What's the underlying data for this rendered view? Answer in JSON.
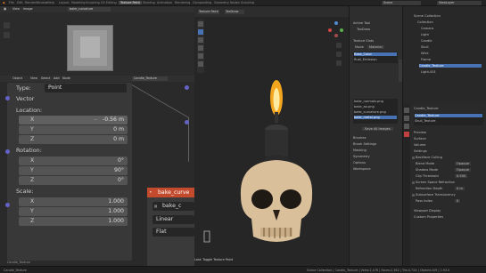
{
  "topbar": {
    "menus": [
      "File",
      "Edit",
      "Render",
      "Window",
      "Help"
    ],
    "workspaces": [
      "Layout",
      "Modeling",
      "Sculpting",
      "UV Editing",
      "Texture Paint",
      "Shading",
      "Animation",
      "Rendering",
      "Compositing",
      "Geometry Nodes",
      "Scripting"
    ],
    "active_workspace": "Texture Paint",
    "scene": "Scene",
    "view_layer": "ViewLayer"
  },
  "image_editor": {
    "menus": [
      "View",
      "Image"
    ],
    "image_name": "bake_curvature"
  },
  "node_editor": {
    "header": [
      "Object",
      "View",
      "Select",
      "Add",
      "Node"
    ],
    "material": "Candle_Texture",
    "panel": {
      "type_label": "Type:",
      "type_value": "Point",
      "vector_label": "Vector",
      "location_label": "Location:",
      "location": [
        {
          "axis": "X",
          "value": "-0.56 m"
        },
        {
          "axis": "Y",
          "value": "0 m"
        },
        {
          "axis": "Z",
          "value": "0 m"
        }
      ],
      "rotation_label": "Rotation:",
      "rotation": [
        {
          "axis": "X",
          "value": "0°"
        },
        {
          "axis": "Y",
          "value": "90°"
        },
        {
          "axis": "Z",
          "value": "0°"
        }
      ],
      "scale_label": "Scale:",
      "scale": [
        {
          "axis": "X",
          "value": "1.000"
        },
        {
          "axis": "Y",
          "value": "1.000"
        },
        {
          "axis": "Z",
          "value": "1.000"
        }
      ]
    },
    "bake_node": {
      "title": "bake_curve",
      "image": "bake_c",
      "interp": "Linear",
      "proj": "Flat"
    },
    "footer_label": "Candle_Texture"
  },
  "viewport": {
    "mode": "Texture Paint",
    "brush": "TexDraw",
    "overlay_label": "Last: Toggle Texture Paint"
  },
  "tool_panel": {
    "tabs": [
      "Tool",
      "View"
    ],
    "active_tool_label": "Active Tool",
    "brush_name": "TexDraw",
    "texture_slots_label": "Texture Slots",
    "mode_label": "Mode",
    "mode_value": "Material",
    "slots": [
      "Base_Color",
      "Rust_Emission"
    ],
    "image_list": [
      "bake_normals.png",
      "bake_ao.png",
      "bake_curvature.png",
      "bake_metal.png"
    ],
    "save_label": "Save All Images",
    "sections": [
      "Brushes",
      "Brush Settings",
      "Masking",
      "Symmetry",
      "Options",
      "Workspace"
    ]
  },
  "outliner": {
    "title": "Scene Collection",
    "items": [
      "Collection",
      "Camera",
      "Light",
      "Candle",
      "Skull",
      "Wick",
      "Flame",
      "Candle_Texture",
      "Light.001"
    ]
  },
  "properties": {
    "object": "Candle_Texture",
    "material_slots": [
      "Candle_Texture",
      "Skull_Texture"
    ],
    "sections": [
      "Preview",
      "Surface",
      "Volume",
      "Settings"
    ],
    "fields": [
      {
        "k": "Backface Culling",
        "v": ""
      },
      {
        "k": "Blend Mode",
        "v": "Opaque"
      },
      {
        "k": "Shadow Mode",
        "v": "Opaque"
      },
      {
        "k": "Clip Threshold",
        "v": "0.500"
      },
      {
        "k": "Screen Space Refraction",
        "v": ""
      },
      {
        "k": "Refraction Depth",
        "v": "0 m"
      },
      {
        "k": "Subsurface Translucency",
        "v": ""
      },
      {
        "k": "Pass Index",
        "v": "0"
      }
    ],
    "more": [
      "Viewport Display",
      "Custom Properties"
    ]
  },
  "status": {
    "left": "Candle_Texture",
    "right": "Scene Collection | Candle_Texture | Verts:2,476 | Faces:2,362 | Tris:4,724 | Objects:0/9 | 2.93.0"
  }
}
